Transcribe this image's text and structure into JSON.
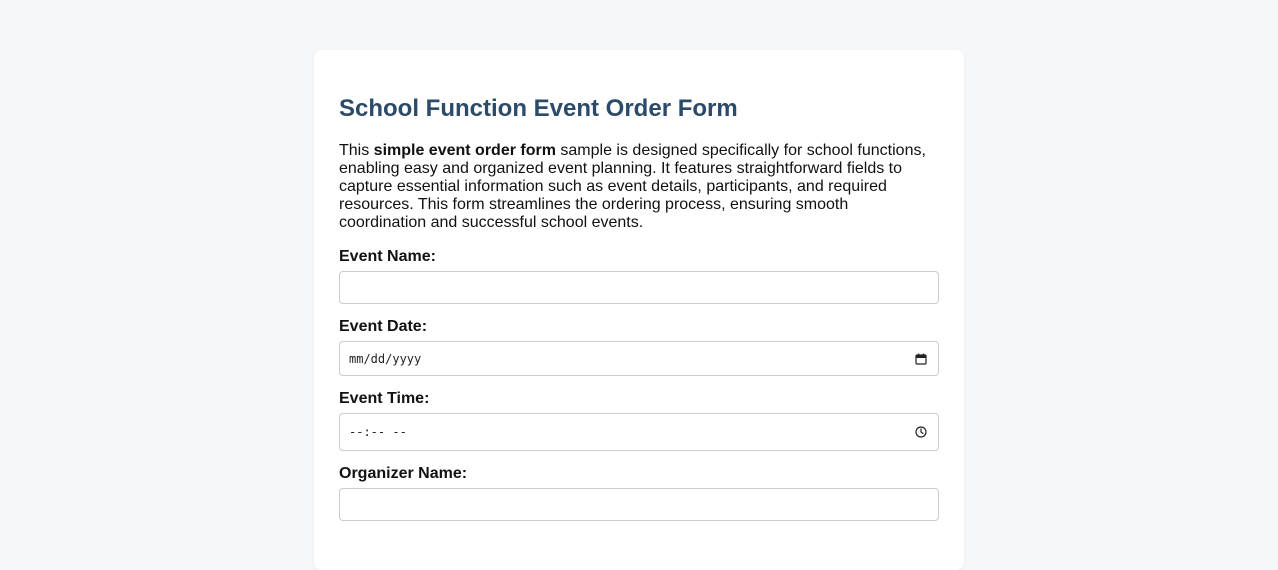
{
  "form": {
    "title": "School Function Event Order Form",
    "intro": {
      "prefix": "This ",
      "bold": "simple event order form",
      "suffix": " sample is designed specifically for school functions, enabling easy and organized event planning. It features straightforward fields to capture essential information such as event details, participants, and required resources. This form streamlines the ordering process, ensuring smooth coordination and successful school events."
    },
    "fields": {
      "event_name": {
        "label": "Event Name:",
        "value": ""
      },
      "event_date": {
        "label": "Event Date:",
        "placeholder": "mm/dd/yyyy",
        "icon": "calendar-icon"
      },
      "event_time": {
        "label": "Event Time:",
        "placeholder": "--:-- --",
        "icon": "clock-icon"
      },
      "organizer_name": {
        "label": "Organizer Name:",
        "value": ""
      }
    }
  },
  "colors": {
    "page_background": "#f6f7f9",
    "card_background": "#ffffff",
    "title": "#2c4a69",
    "input_border": "#c9ccd1"
  }
}
